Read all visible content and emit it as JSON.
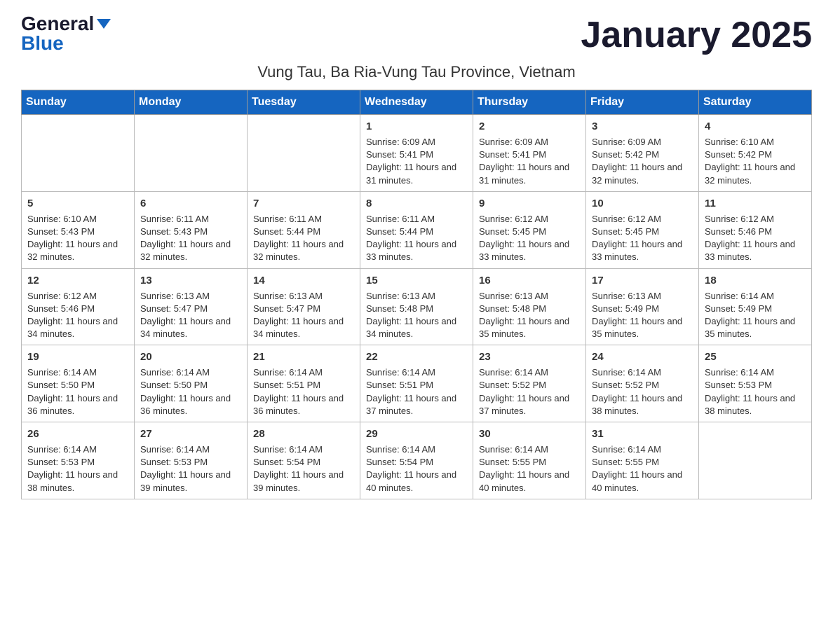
{
  "logo": {
    "general": "General",
    "blue": "Blue"
  },
  "title": "January 2025",
  "subtitle": "Vung Tau, Ba Ria-Vung Tau Province, Vietnam",
  "days_header": [
    "Sunday",
    "Monday",
    "Tuesday",
    "Wednesday",
    "Thursday",
    "Friday",
    "Saturday"
  ],
  "weeks": [
    [
      {
        "day": "",
        "info": ""
      },
      {
        "day": "",
        "info": ""
      },
      {
        "day": "",
        "info": ""
      },
      {
        "day": "1",
        "info": "Sunrise: 6:09 AM\nSunset: 5:41 PM\nDaylight: 11 hours and 31 minutes."
      },
      {
        "day": "2",
        "info": "Sunrise: 6:09 AM\nSunset: 5:41 PM\nDaylight: 11 hours and 31 minutes."
      },
      {
        "day": "3",
        "info": "Sunrise: 6:09 AM\nSunset: 5:42 PM\nDaylight: 11 hours and 32 minutes."
      },
      {
        "day": "4",
        "info": "Sunrise: 6:10 AM\nSunset: 5:42 PM\nDaylight: 11 hours and 32 minutes."
      }
    ],
    [
      {
        "day": "5",
        "info": "Sunrise: 6:10 AM\nSunset: 5:43 PM\nDaylight: 11 hours and 32 minutes."
      },
      {
        "day": "6",
        "info": "Sunrise: 6:11 AM\nSunset: 5:43 PM\nDaylight: 11 hours and 32 minutes."
      },
      {
        "day": "7",
        "info": "Sunrise: 6:11 AM\nSunset: 5:44 PM\nDaylight: 11 hours and 32 minutes."
      },
      {
        "day": "8",
        "info": "Sunrise: 6:11 AM\nSunset: 5:44 PM\nDaylight: 11 hours and 33 minutes."
      },
      {
        "day": "9",
        "info": "Sunrise: 6:12 AM\nSunset: 5:45 PM\nDaylight: 11 hours and 33 minutes."
      },
      {
        "day": "10",
        "info": "Sunrise: 6:12 AM\nSunset: 5:45 PM\nDaylight: 11 hours and 33 minutes."
      },
      {
        "day": "11",
        "info": "Sunrise: 6:12 AM\nSunset: 5:46 PM\nDaylight: 11 hours and 33 minutes."
      }
    ],
    [
      {
        "day": "12",
        "info": "Sunrise: 6:12 AM\nSunset: 5:46 PM\nDaylight: 11 hours and 34 minutes."
      },
      {
        "day": "13",
        "info": "Sunrise: 6:13 AM\nSunset: 5:47 PM\nDaylight: 11 hours and 34 minutes."
      },
      {
        "day": "14",
        "info": "Sunrise: 6:13 AM\nSunset: 5:47 PM\nDaylight: 11 hours and 34 minutes."
      },
      {
        "day": "15",
        "info": "Sunrise: 6:13 AM\nSunset: 5:48 PM\nDaylight: 11 hours and 34 minutes."
      },
      {
        "day": "16",
        "info": "Sunrise: 6:13 AM\nSunset: 5:48 PM\nDaylight: 11 hours and 35 minutes."
      },
      {
        "day": "17",
        "info": "Sunrise: 6:13 AM\nSunset: 5:49 PM\nDaylight: 11 hours and 35 minutes."
      },
      {
        "day": "18",
        "info": "Sunrise: 6:14 AM\nSunset: 5:49 PM\nDaylight: 11 hours and 35 minutes."
      }
    ],
    [
      {
        "day": "19",
        "info": "Sunrise: 6:14 AM\nSunset: 5:50 PM\nDaylight: 11 hours and 36 minutes."
      },
      {
        "day": "20",
        "info": "Sunrise: 6:14 AM\nSunset: 5:50 PM\nDaylight: 11 hours and 36 minutes."
      },
      {
        "day": "21",
        "info": "Sunrise: 6:14 AM\nSunset: 5:51 PM\nDaylight: 11 hours and 36 minutes."
      },
      {
        "day": "22",
        "info": "Sunrise: 6:14 AM\nSunset: 5:51 PM\nDaylight: 11 hours and 37 minutes."
      },
      {
        "day": "23",
        "info": "Sunrise: 6:14 AM\nSunset: 5:52 PM\nDaylight: 11 hours and 37 minutes."
      },
      {
        "day": "24",
        "info": "Sunrise: 6:14 AM\nSunset: 5:52 PM\nDaylight: 11 hours and 38 minutes."
      },
      {
        "day": "25",
        "info": "Sunrise: 6:14 AM\nSunset: 5:53 PM\nDaylight: 11 hours and 38 minutes."
      }
    ],
    [
      {
        "day": "26",
        "info": "Sunrise: 6:14 AM\nSunset: 5:53 PM\nDaylight: 11 hours and 38 minutes."
      },
      {
        "day": "27",
        "info": "Sunrise: 6:14 AM\nSunset: 5:53 PM\nDaylight: 11 hours and 39 minutes."
      },
      {
        "day": "28",
        "info": "Sunrise: 6:14 AM\nSunset: 5:54 PM\nDaylight: 11 hours and 39 minutes."
      },
      {
        "day": "29",
        "info": "Sunrise: 6:14 AM\nSunset: 5:54 PM\nDaylight: 11 hours and 40 minutes."
      },
      {
        "day": "30",
        "info": "Sunrise: 6:14 AM\nSunset: 5:55 PM\nDaylight: 11 hours and 40 minutes."
      },
      {
        "day": "31",
        "info": "Sunrise: 6:14 AM\nSunset: 5:55 PM\nDaylight: 11 hours and 40 minutes."
      },
      {
        "day": "",
        "info": ""
      }
    ]
  ]
}
